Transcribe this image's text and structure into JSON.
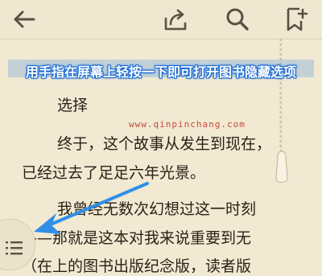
{
  "toolbar": {
    "back_icon": "back-arrow-icon",
    "share_icon": "share-icon",
    "search_icon": "search-icon",
    "bookmark_icon": "bookmark-add-icon"
  },
  "banner": {
    "text": "用手指在屏幕上轻按一下即可打开图书隐藏选项"
  },
  "reader": {
    "lines": [
      "选择",
      "终于，这个故事从发生到现在，",
      "已经过去了足足六年光景。",
      "我曾经无数次幻想过这一时刻",
      "——那就是这本对我来说重要到无",
      "（在上的图书出版纪念版，读者版"
    ],
    "watermark": "www.qinpinchang.com"
  },
  "menu": {
    "icon": "list-menu-icon"
  },
  "colors": {
    "background": "#f1e9d2",
    "text": "#2a2218",
    "accent_arrow": "#2f8fe8",
    "banner_outline": "#1a6bd6"
  }
}
